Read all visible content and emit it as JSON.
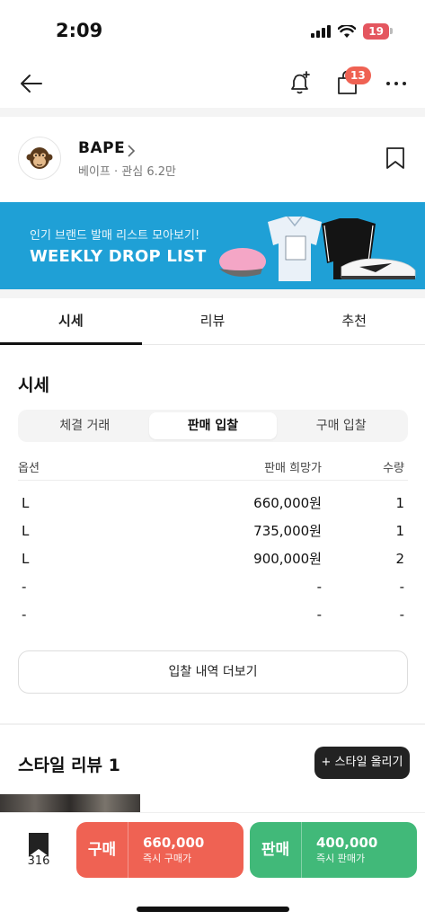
{
  "status": {
    "time": "2:09",
    "battery": "19"
  },
  "nav": {
    "cart_badge": "13"
  },
  "brand": {
    "name": "BAPE",
    "subtitle": "베이프 · 관심 6.2만"
  },
  "banner": {
    "subtitle": "인기 브랜드 발매 리스트 모아보기!",
    "title": "WEEKLY DROP LIST",
    "bg_color": "#1fa0d6"
  },
  "tabs": [
    {
      "label": "시세",
      "active": true
    },
    {
      "label": "리뷰",
      "active": false
    },
    {
      "label": "추천",
      "active": false
    }
  ],
  "price_section": {
    "title": "시세",
    "segments": [
      {
        "label": "체결 거래",
        "active": false
      },
      {
        "label": "판매 입찰",
        "active": true
      },
      {
        "label": "구매 입찰",
        "active": false
      }
    ],
    "columns": [
      "옵션",
      "판매 희망가",
      "수량"
    ],
    "rows": [
      [
        "L",
        "660,000원",
        "1"
      ],
      [
        "L",
        "735,000원",
        "1"
      ],
      [
        "L",
        "900,000원",
        "2"
      ],
      [
        "-",
        "-",
        "-"
      ],
      [
        "-",
        "-",
        "-"
      ]
    ],
    "more_button": "입찰 내역 더보기"
  },
  "style_review": {
    "title": "스타일 리뷰 1",
    "upload_button": "+ 스타일 올리기"
  },
  "bottom_bar": {
    "bookmark_count": "316",
    "buy": {
      "label": "구매",
      "price": "660,000",
      "sub": "즉시 구매가",
      "color": "#ef6253"
    },
    "sell": {
      "label": "판매",
      "price": "400,000",
      "sub": "즉시 판매가",
      "color": "#41b979"
    }
  }
}
